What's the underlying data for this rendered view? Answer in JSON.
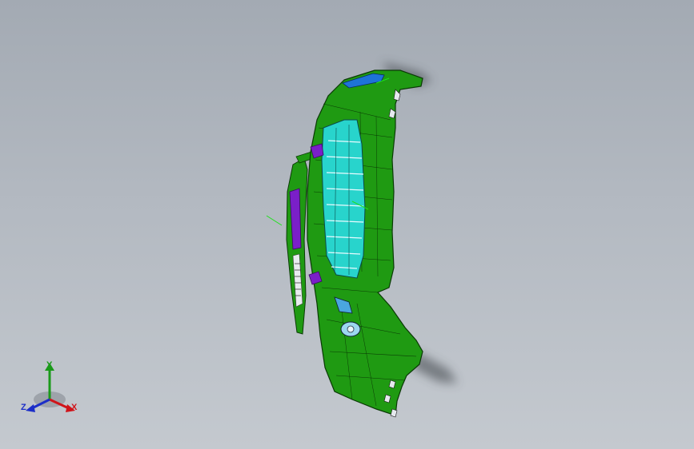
{
  "viewport": {
    "background_top": "#a3aab3",
    "background_bottom": "#c4c9cf"
  },
  "model": {
    "body_color": "#1f9a12",
    "edge_color": "#0a3a05",
    "grille_color": "#28d4cc",
    "accent_blue": "#1e73d8",
    "accent_purple": "#7a1fc8"
  },
  "triad": {
    "x_label": "X",
    "y_label": "Y",
    "z_label": "Z",
    "x_color": "#d0141a",
    "y_color": "#1a9a1a",
    "z_color": "#1c2ec8"
  }
}
